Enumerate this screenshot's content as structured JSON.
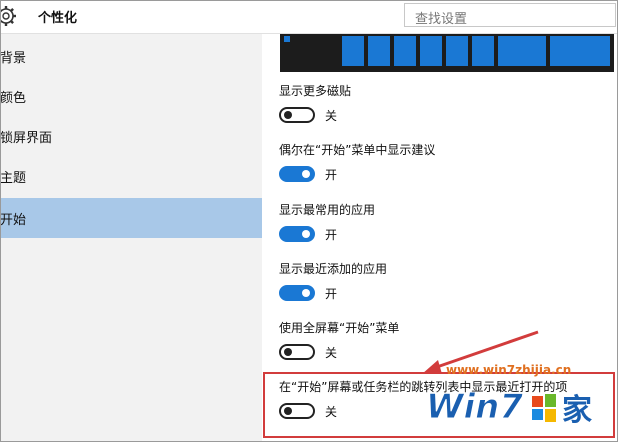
{
  "header": {
    "title": "个性化",
    "search_placeholder": "查找设置"
  },
  "sidebar": {
    "items": [
      {
        "label": "背景",
        "selected": false
      },
      {
        "label": "颜色",
        "selected": false
      },
      {
        "label": "锁屏界面",
        "selected": false
      },
      {
        "label": "主题",
        "selected": false
      },
      {
        "label": "开始",
        "selected": true
      }
    ]
  },
  "settings": [
    {
      "label": "显示更多磁贴",
      "state": "关",
      "on": false
    },
    {
      "label": "偶尔在“开始”菜单中显示建议",
      "state": "开",
      "on": true
    },
    {
      "label": "显示最常用的应用",
      "state": "开",
      "on": true
    },
    {
      "label": "显示最近添加的应用",
      "state": "开",
      "on": true
    },
    {
      "label": "使用全屏幕“开始”菜单",
      "state": "关",
      "on": false
    },
    {
      "label": "在“开始”屏幕或任务栏的跳转列表中显示最近打开的项",
      "state": "关",
      "on": false
    }
  ],
  "watermark": {
    "url": "www.win7zhijia.cn",
    "logo_text": "Win7",
    "logo_suffix": "家"
  },
  "colors": {
    "accent": "#1a78d4",
    "selected_nav": "#a8c8e8",
    "highlight": "#d23c3c",
    "watermark": "#e07020"
  }
}
